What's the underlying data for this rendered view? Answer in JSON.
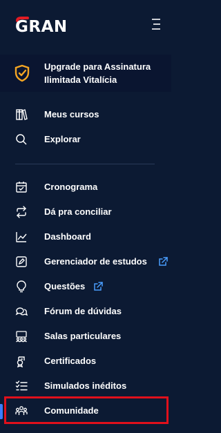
{
  "brand": {
    "logo_text": "GRAN"
  },
  "upgrade": {
    "label": "Upgrade para Assinatura Ilimitada Vitalícia"
  },
  "nav": {
    "items": [
      {
        "label": "Meus cursos",
        "icon": "books-icon"
      },
      {
        "label": "Explorar",
        "icon": "search-icon"
      },
      {
        "label": "Cronograma",
        "icon": "calendar-icon"
      },
      {
        "label": "Dá pra conciliar",
        "icon": "arrows-icon"
      },
      {
        "label": "Dashboard",
        "icon": "chart-line-icon"
      },
      {
        "label": "Gerenciador de estudos",
        "icon": "edit-icon",
        "external": true
      },
      {
        "label": "Questões",
        "icon": "lightbulb-icon",
        "external": true
      },
      {
        "label": "Fórum de dúvidas",
        "icon": "chat-icon"
      },
      {
        "label": "Salas particulares",
        "icon": "group-icon"
      },
      {
        "label": "Certificados",
        "icon": "certificate-icon"
      },
      {
        "label": "Simulados inéditos",
        "icon": "checklist-icon"
      },
      {
        "label": "Comunidade",
        "icon": "community-icon"
      }
    ]
  },
  "colors": {
    "background": "#0c1a33",
    "brand_red": "#e31b23",
    "highlight_border": "#e0101b",
    "external_link": "#4a9eff",
    "upgrade_icon": "#f5a623"
  }
}
